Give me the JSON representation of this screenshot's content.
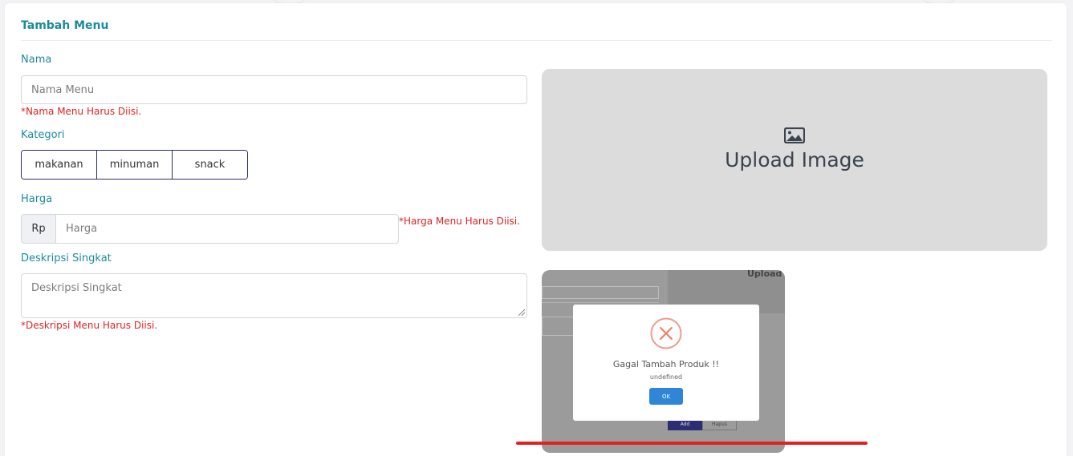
{
  "form": {
    "title": "Tambah Menu",
    "nama": {
      "label": "Nama",
      "placeholder": "Nama Menu",
      "error": "*Nama Menu Harus Diisi."
    },
    "kategori": {
      "label": "Kategori",
      "options": [
        "makanan",
        "minuman",
        "snack"
      ]
    },
    "harga": {
      "label": "Harga",
      "prefix": "Rp",
      "placeholder": "Harga",
      "error": "*Harga Menu Harus Diisi."
    },
    "deskripsi": {
      "label": "Deskripsi Singkat",
      "placeholder": "Deskripsi Singkat",
      "error": "*Deskripsi Menu Harus Diisi."
    }
  },
  "upload": {
    "icon": "image-icon",
    "label": "Upload Image"
  },
  "preview": {
    "bg_text": "Upload",
    "bg_buttons": [
      "Add",
      "Hapus"
    ]
  },
  "dialog": {
    "icon": "x-circle-icon",
    "title": "Gagal Tambah Produk !!",
    "message": "undefined",
    "ok_label": "OK"
  },
  "colors": {
    "accent": "#1c8a9e",
    "error": "#e02222",
    "navy": "#2c2d72",
    "ok_button": "#2f86d6"
  }
}
